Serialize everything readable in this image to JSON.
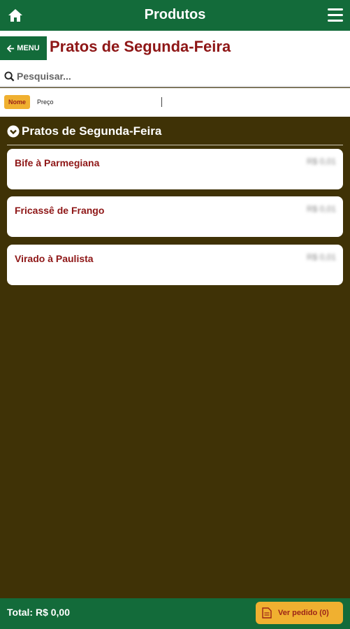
{
  "topbar": {
    "title": "Produtos",
    "home_icon": "home-icon",
    "menu_icon": "hamburger-icon"
  },
  "subhead": {
    "menu_label": "MENU",
    "page_title": "Pratos de Segunda-Feira"
  },
  "search": {
    "placeholder": "Pesquisar..."
  },
  "sort": {
    "options": [
      "Nome",
      "Preço"
    ],
    "selected": "Nome"
  },
  "section": {
    "title": "Pratos de Segunda-Feira"
  },
  "items": [
    {
      "name": "Bife à Parmegiana",
      "price": "R$ 0,01"
    },
    {
      "name": "Fricassê de Frango",
      "price": "R$ 0,01"
    },
    {
      "name": "Virado à Paulista",
      "price": "R$ 0,01"
    }
  ],
  "footer": {
    "total": "Total: R$ 0,00",
    "order_button": "Ver pedido (0)"
  },
  "colors": {
    "primary_green": "#136b3a",
    "background_brown": "#3f3206",
    "title_red": "#8e1616",
    "accent_yellow": "#f0b030"
  }
}
